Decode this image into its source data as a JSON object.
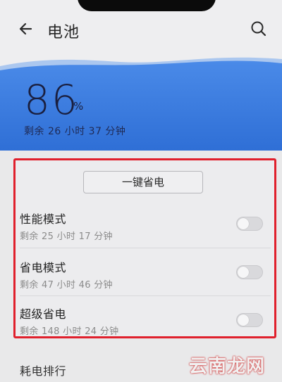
{
  "header": {
    "title": "电池",
    "back_icon": "arrow-left-icon",
    "search_icon": "search-icon"
  },
  "battery": {
    "level_value": "86",
    "level_unit": "%",
    "remaining": "剩余 26 小时 37 分钟"
  },
  "power_saving": {
    "one_click_label": "一键省电",
    "modes": [
      {
        "title": "性能模式",
        "remaining": "剩余 25 小时 17 分钟",
        "enabled": false
      },
      {
        "title": "省电模式",
        "remaining": "剩余 47 小时 46 分钟",
        "enabled": false
      },
      {
        "title": "超级省电",
        "remaining": "剩余 148 小时 24 分钟",
        "enabled": false
      }
    ]
  },
  "menu": {
    "power_ranking_label": "耗电排行"
  },
  "watermark": "云南龙网",
  "colors": {
    "accent_blue": "#3b7de0",
    "highlight_red": "#e0202c"
  }
}
